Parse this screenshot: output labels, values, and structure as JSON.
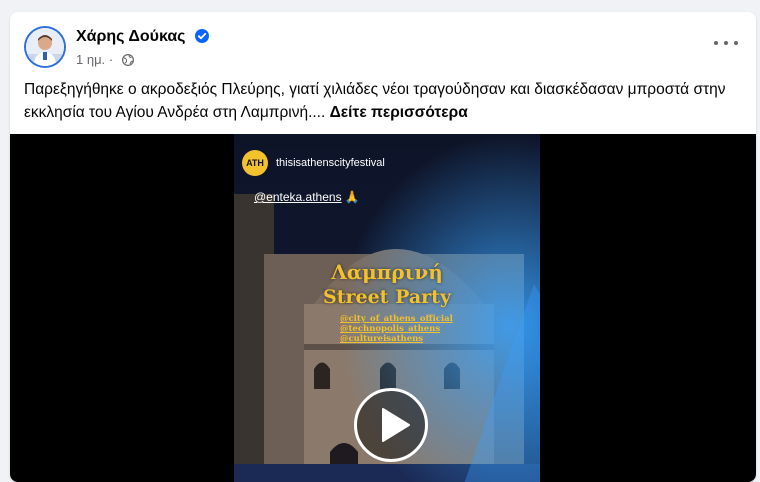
{
  "post": {
    "author": "Χάρης Δούκας",
    "time": "1 ημ.",
    "separator": "·",
    "text": "Παρεξηγήθηκε ο ακροδεξιός Πλεύρης, γιατί χιλιάδες νέοι τραγούδησαν και διασκέδασαν μπροστά στην εκκλησία του Αγίου Ανδρέα στη Λαμπρινή....",
    "see_more": "Δείτε περισσότερα"
  },
  "video": {
    "logo_text": "ATH",
    "handle": "thisisathenscityfestival",
    "mention": "@enteka.athens",
    "mention_emoji": "🙏",
    "headline_1": "Λαμπρινή",
    "headline_2": "Street Party",
    "tags": [
      "@city_of_athens_official",
      "@technopolis_athens",
      "@cultureisathens"
    ]
  },
  "colors": {
    "brand_blue": "#0866ff",
    "yellow": "#f2c12e",
    "text": "#050505",
    "secondary": "#65676b"
  },
  "icons": [
    "verified-badge-icon",
    "globe-icon",
    "more-options-icon",
    "play-icon"
  ]
}
